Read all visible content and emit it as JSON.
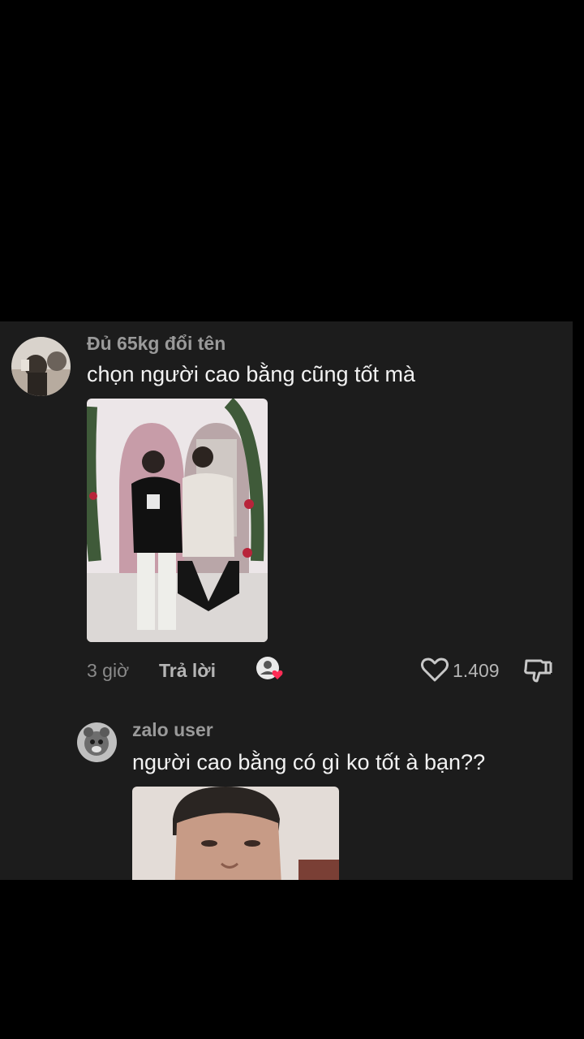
{
  "comments": [
    {
      "username": "Đủ 65kg đổi tên",
      "text": "chọn người cao bằng cũng tốt mà",
      "time": "3 giờ",
      "reply_label": "Trả lời",
      "likes": "1.409"
    },
    {
      "username": "zalo user",
      "text": "người cao bằng có gì ko tốt à bạn??"
    }
  ],
  "icons": {
    "like": "heart-outline-icon",
    "dislike": "thumbs-down-icon",
    "creator_liked": "creator-liked-badge-icon"
  }
}
